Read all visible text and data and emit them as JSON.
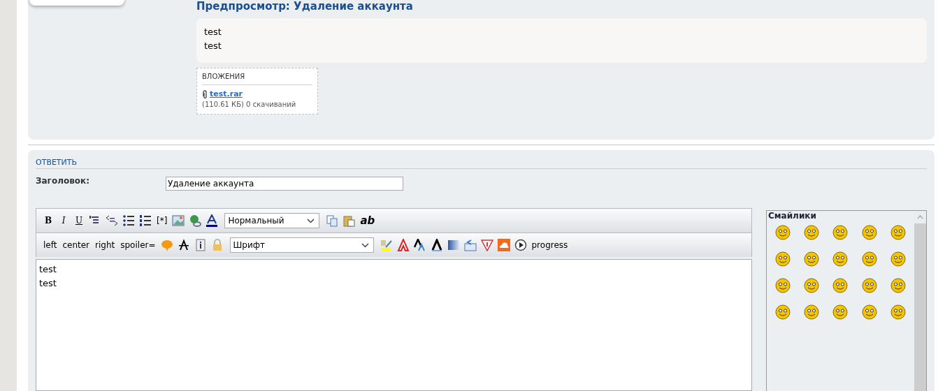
{
  "preview": {
    "title": "Предпросмотр: Удаление аккаунта",
    "body_lines": [
      "test",
      "test"
    ],
    "attachments": {
      "heading": "ВЛОЖЕНИЯ",
      "file": "test.rar",
      "meta": "(110.61 КБ) 0 скачиваний"
    }
  },
  "reply": {
    "heading": "ОТВЕТИТЬ",
    "subject_label": "Заголовок:",
    "subject_value": "Удаление аккаунта",
    "toolbar_rows": [
      [
        {
          "kind": "text",
          "label": "B"
        },
        {
          "kind": "text",
          "label": "I"
        },
        {
          "kind": "text",
          "label": "U"
        },
        {
          "kind": "icon"
        },
        {
          "kind": "icon"
        },
        {
          "kind": "icon"
        },
        {
          "kind": "icon"
        },
        {
          "kind": "text",
          "label": "[*]"
        },
        {
          "kind": "icon"
        },
        {
          "kind": "icon"
        },
        {
          "kind": "icon"
        },
        {
          "kind": "select",
          "label": "Нормальный"
        },
        {
          "kind": "icon"
        },
        {
          "kind": "icon"
        },
        {
          "kind": "text",
          "label": "ab"
        }
      ],
      [
        {
          "kind": "text",
          "label": "left"
        },
        {
          "kind": "text",
          "label": "center"
        },
        {
          "kind": "text",
          "label": "right"
        },
        {
          "kind": "text",
          "label": "spoiler="
        },
        {
          "kind": "icon"
        },
        {
          "kind": "icon"
        },
        {
          "kind": "icon"
        },
        {
          "kind": "icon"
        },
        {
          "kind": "select",
          "label": "Шрифт"
        },
        {
          "kind": "icon"
        },
        {
          "kind": "icon"
        },
        {
          "kind": "icon"
        },
        {
          "kind": "icon"
        },
        {
          "kind": "icon"
        },
        {
          "kind": "icon"
        },
        {
          "kind": "icon"
        },
        {
          "kind": "icon"
        },
        {
          "kind": "icon"
        },
        {
          "kind": "text",
          "label": "progress"
        }
      ]
    ],
    "message_lines": [
      "test",
      "test"
    ],
    "smilies": {
      "title": "Смайлики"
    }
  }
}
